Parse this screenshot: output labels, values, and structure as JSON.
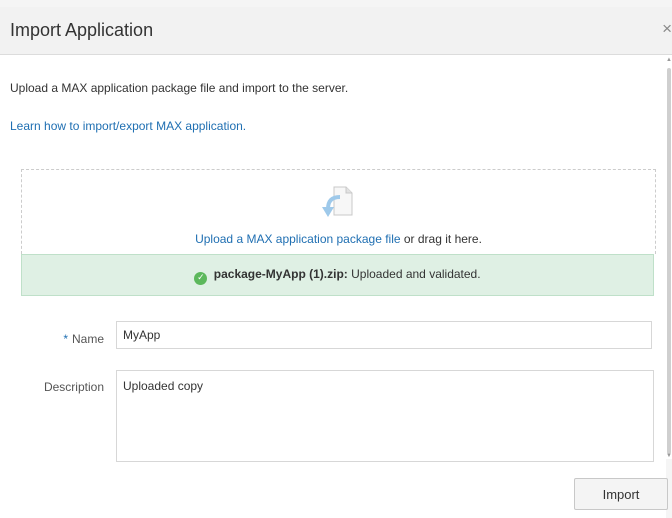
{
  "dialog": {
    "title": "Import Application",
    "close_glyph": "×"
  },
  "intro_text": "Upload a MAX application package file and import to the server.",
  "learn_link": "Learn how to import/export MAX application.",
  "dropzone": {
    "icon": "file-upload-icon",
    "link_text": "Upload a MAX application package file",
    "suffix_text": " or drag it here."
  },
  "status": {
    "icon": "check-circle-icon",
    "check_glyph": "✓",
    "filename": "package-MyApp (1).zip:",
    "message": " Uploaded and validated.",
    "color": "#dff0e4"
  },
  "form": {
    "name_star": "*",
    "name_label": "Name",
    "name_value": "MyApp",
    "description_label": "Description",
    "description_value": "Uploaded copy"
  },
  "actions": {
    "import_label": "Import"
  },
  "colors": {
    "link": "#1f6fb2",
    "success_icon": "#5cb85c"
  }
}
